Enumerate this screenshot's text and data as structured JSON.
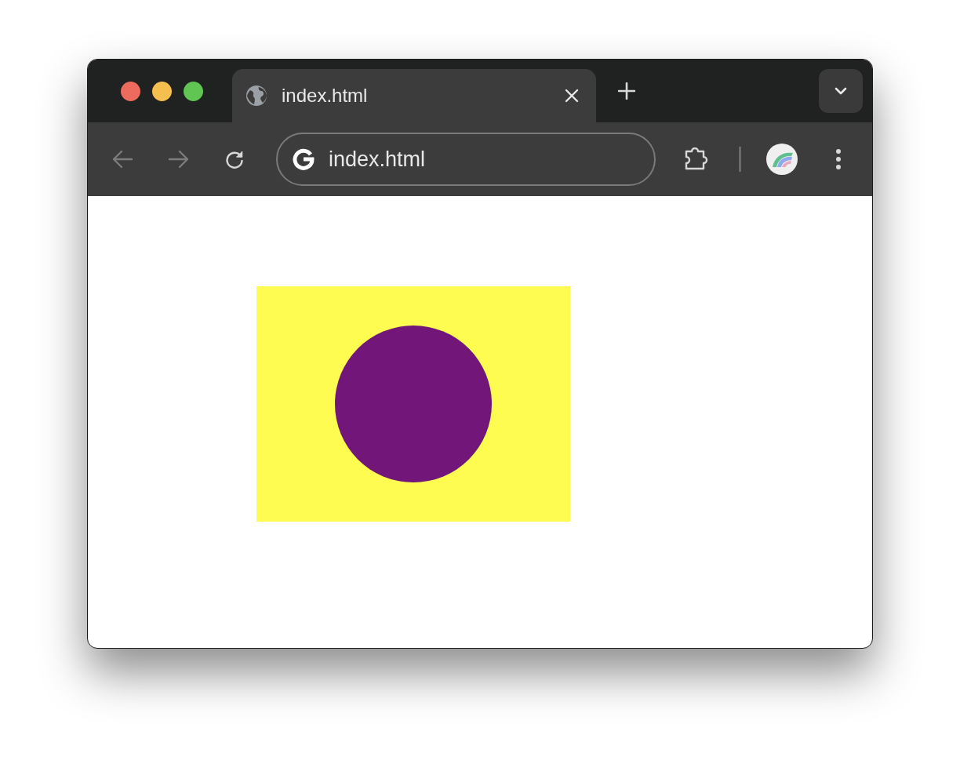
{
  "tabs": [
    {
      "title": "index.html",
      "selected": true
    }
  ],
  "toolbar": {
    "back_disabled": true,
    "forward_disabled": true,
    "address": "index.html"
  }
}
